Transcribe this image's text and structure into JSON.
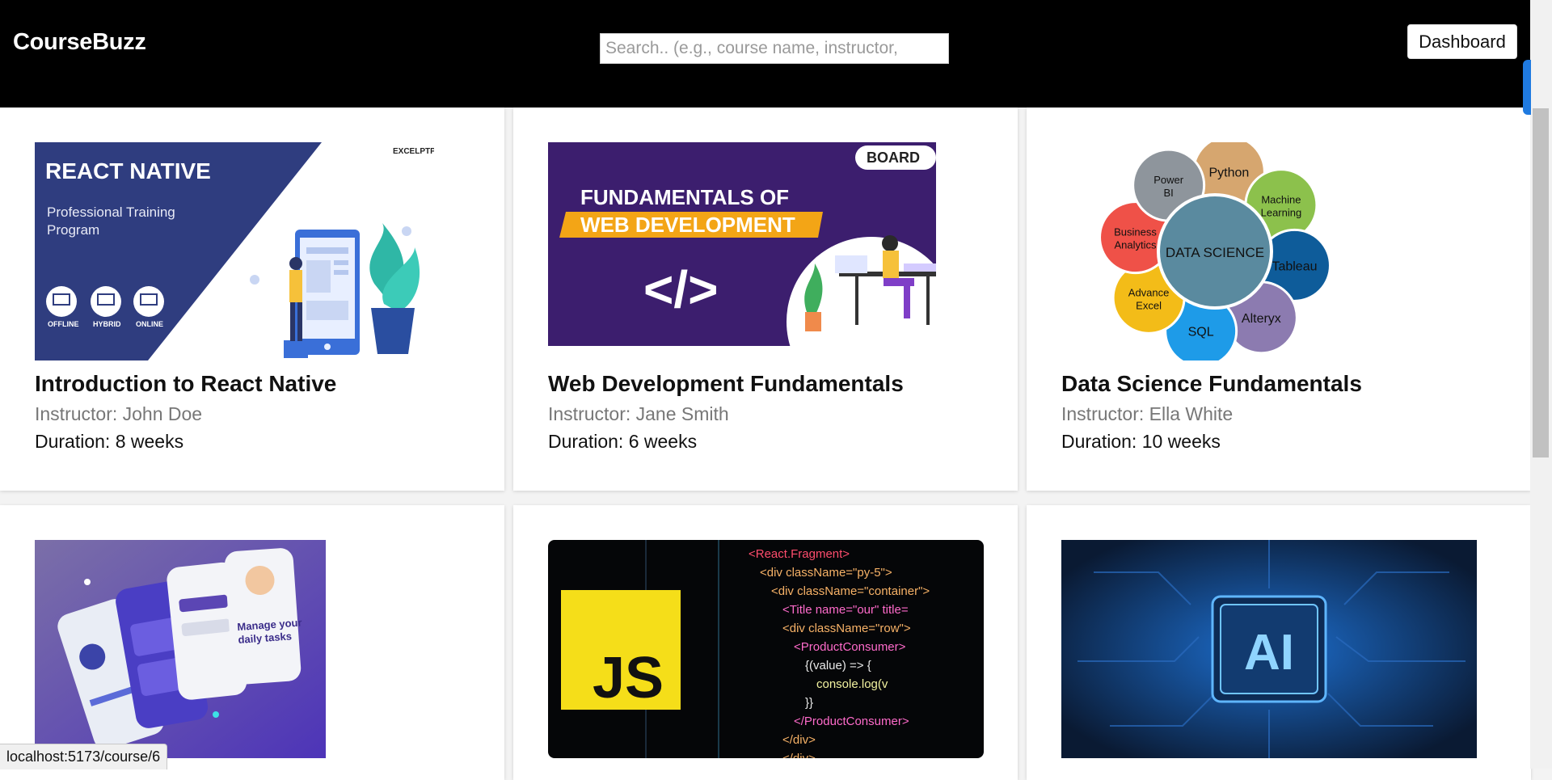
{
  "header": {
    "brand": "CourseBuzz",
    "search_placeholder": "Search.. (e.g., course name, instructor,",
    "dashboard_label": "Dashboard"
  },
  "courses": [
    {
      "title": "Introduction to React Native",
      "instructor": "Instructor: John Doe",
      "duration": "Duration: 8 weeks",
      "thumbnail": {
        "heading": "REACT NATIVE",
        "sub1": "Professional Training",
        "sub2": "Program",
        "brand": "EXCELPTP",
        "modes": [
          "OFFLINE",
          "HYBRID",
          "ONLINE"
        ],
        "bg": "#2f3d7f"
      }
    },
    {
      "title": "Web Development Fundamentals",
      "instructor": "Instructor: Jane Smith",
      "duration": "Duration: 6 weeks",
      "thumbnail": {
        "line1": "FUNDAMENTALS OF",
        "line2": "WEB DEVELOPMENT",
        "brand": "BOARD",
        "code_symbol": "</>",
        "bg": "#3c1e6e",
        "ribbon": "#f3a516"
      }
    },
    {
      "title": "Data Science Fundamentals",
      "instructor": "Instructor: Ella White",
      "duration": "Duration: 10 weeks",
      "thumbnail": {
        "center": "DATA SCIENCE",
        "petals": [
          {
            "label1": "Python",
            "label2": "",
            "color": "#d6a66f"
          },
          {
            "label1": "Machine",
            "label2": "Learning",
            "color": "#8cc14c"
          },
          {
            "label1": "Tableau",
            "label2": "",
            "color": "#0e5c9a"
          },
          {
            "label1": "Alteryx",
            "label2": "",
            "color": "#8c7bb0"
          },
          {
            "label1": "SQL",
            "label2": "",
            "color": "#1e9be8"
          },
          {
            "label1": "Advance",
            "label2": "Excel",
            "color": "#f3bc18"
          },
          {
            "label1": "Business",
            "label2": "Analytics",
            "color": "#ef5148"
          },
          {
            "label1": "Power",
            "label2": "BI",
            "color": "#8e959c"
          }
        ]
      }
    },
    {
      "title": "",
      "thumbnail": {
        "phone_text1": "Manage your",
        "phone_text2": "daily tasks",
        "bg": "#5b46b4"
      }
    },
    {
      "title": "",
      "thumbnail": {
        "js_label": "JS",
        "code_lines": [
          "<React.Fragment>",
          "<div className=\"py-5\">",
          "<div className=\"container\">",
          "<Title name=\"our\" title=",
          "<div className=\"row\">",
          "<ProductConsumer>",
          "{(value) => {",
          "console.log(v",
          "}}",
          "</ProductConsumer>",
          "</div>",
          "</div>"
        ]
      }
    },
    {
      "title": "",
      "thumbnail": {
        "chip_label": "AI",
        "bg": "#0a1a33"
      }
    }
  ],
  "statusbar": {
    "url": "localhost:5173/course/6"
  }
}
